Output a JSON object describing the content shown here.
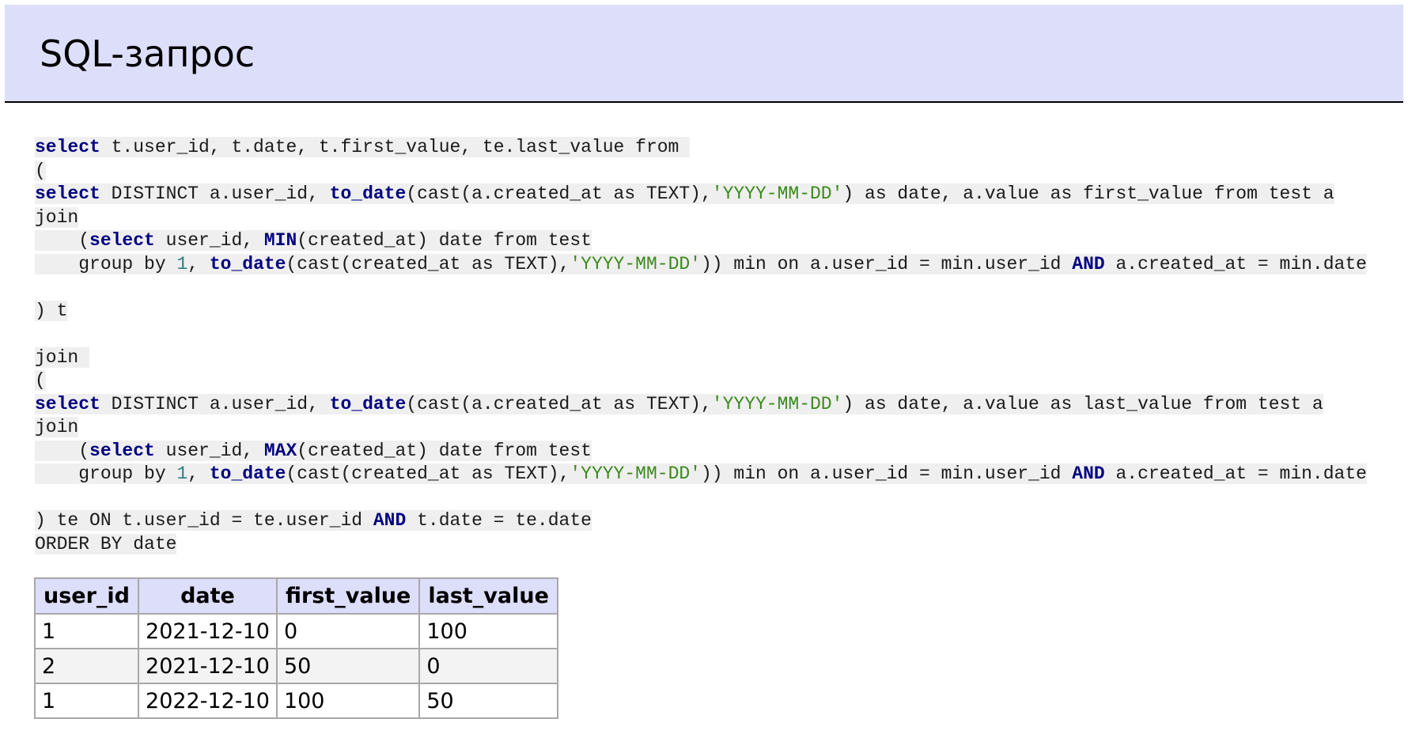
{
  "header": {
    "title": "SQL-запрос"
  },
  "query": {
    "lines": [
      [
        {
          "t": "select",
          "c": "kw"
        },
        {
          "t": " t.user_id, t.date, t.first_value, te.last_value from ",
          "c": ""
        }
      ],
      [
        {
          "t": "(",
          "c": ""
        }
      ],
      [
        {
          "t": "select",
          "c": "kw"
        },
        {
          "t": " DISTINCT a.user_id, ",
          "c": ""
        },
        {
          "t": "to_date",
          "c": "kw"
        },
        {
          "t": "(cast(a.created_at as TEXT),",
          "c": ""
        },
        {
          "t": "'YYYY-MM-DD'",
          "c": "str"
        },
        {
          "t": ") as date, a.value as first_value from test a",
          "c": ""
        }
      ],
      [
        {
          "t": "join",
          "c": ""
        }
      ],
      [
        {
          "t": "    (",
          "c": ""
        },
        {
          "t": "select",
          "c": "kw"
        },
        {
          "t": " user_id, ",
          "c": ""
        },
        {
          "t": "MIN",
          "c": "kw"
        },
        {
          "t": "(created_at) date from test",
          "c": ""
        }
      ],
      [
        {
          "t": "    group by ",
          "c": ""
        },
        {
          "t": "1",
          "c": "num"
        },
        {
          "t": ", ",
          "c": ""
        },
        {
          "t": "to_date",
          "c": "kw"
        },
        {
          "t": "(cast(created_at as TEXT),",
          "c": ""
        },
        {
          "t": "'YYYY-MM-DD'",
          "c": "str"
        },
        {
          "t": ")) min on a.user_id = min.user_id ",
          "c": ""
        },
        {
          "t": "AND",
          "c": "kw"
        },
        {
          "t": " a.created_at = min.date",
          "c": ""
        }
      ],
      [],
      [
        {
          "t": ") t",
          "c": ""
        }
      ],
      [],
      [
        {
          "t": "join ",
          "c": ""
        }
      ],
      [
        {
          "t": "(",
          "c": ""
        }
      ],
      [
        {
          "t": "select",
          "c": "kw"
        },
        {
          "t": " DISTINCT a.user_id, ",
          "c": ""
        },
        {
          "t": "to_date",
          "c": "kw"
        },
        {
          "t": "(cast(a.created_at as TEXT),",
          "c": ""
        },
        {
          "t": "'YYYY-MM-DD'",
          "c": "str"
        },
        {
          "t": ") as date, a.value as last_value from test a",
          "c": ""
        }
      ],
      [
        {
          "t": "join",
          "c": ""
        }
      ],
      [
        {
          "t": "    (",
          "c": ""
        },
        {
          "t": "select",
          "c": "kw"
        },
        {
          "t": " user_id, ",
          "c": ""
        },
        {
          "t": "MAX",
          "c": "kw"
        },
        {
          "t": "(created_at) date from test",
          "c": ""
        }
      ],
      [
        {
          "t": "    group by ",
          "c": ""
        },
        {
          "t": "1",
          "c": "num"
        },
        {
          "t": ", ",
          "c": ""
        },
        {
          "t": "to_date",
          "c": "kw"
        },
        {
          "t": "(cast(created_at as TEXT),",
          "c": ""
        },
        {
          "t": "'YYYY-MM-DD'",
          "c": "str"
        },
        {
          "t": ")) min on a.user_id = min.user_id ",
          "c": ""
        },
        {
          "t": "AND",
          "c": "kw"
        },
        {
          "t": " a.created_at = min.date",
          "c": ""
        }
      ],
      [],
      [
        {
          "t": ") te ON t.user_id = te.user_id ",
          "c": ""
        },
        {
          "t": "AND",
          "c": "kw"
        },
        {
          "t": " t.date = te.date",
          "c": ""
        }
      ],
      [
        {
          "t": "ORDER BY date",
          "c": ""
        }
      ]
    ]
  },
  "result": {
    "columns": [
      "user_id",
      "date",
      "first_value",
      "last_value"
    ],
    "rows": [
      [
        "1",
        "2021-12-10",
        "0",
        "100"
      ],
      [
        "2",
        "2021-12-10",
        "50",
        "0"
      ],
      [
        "1",
        "2022-12-10",
        "100",
        "50"
      ]
    ]
  }
}
